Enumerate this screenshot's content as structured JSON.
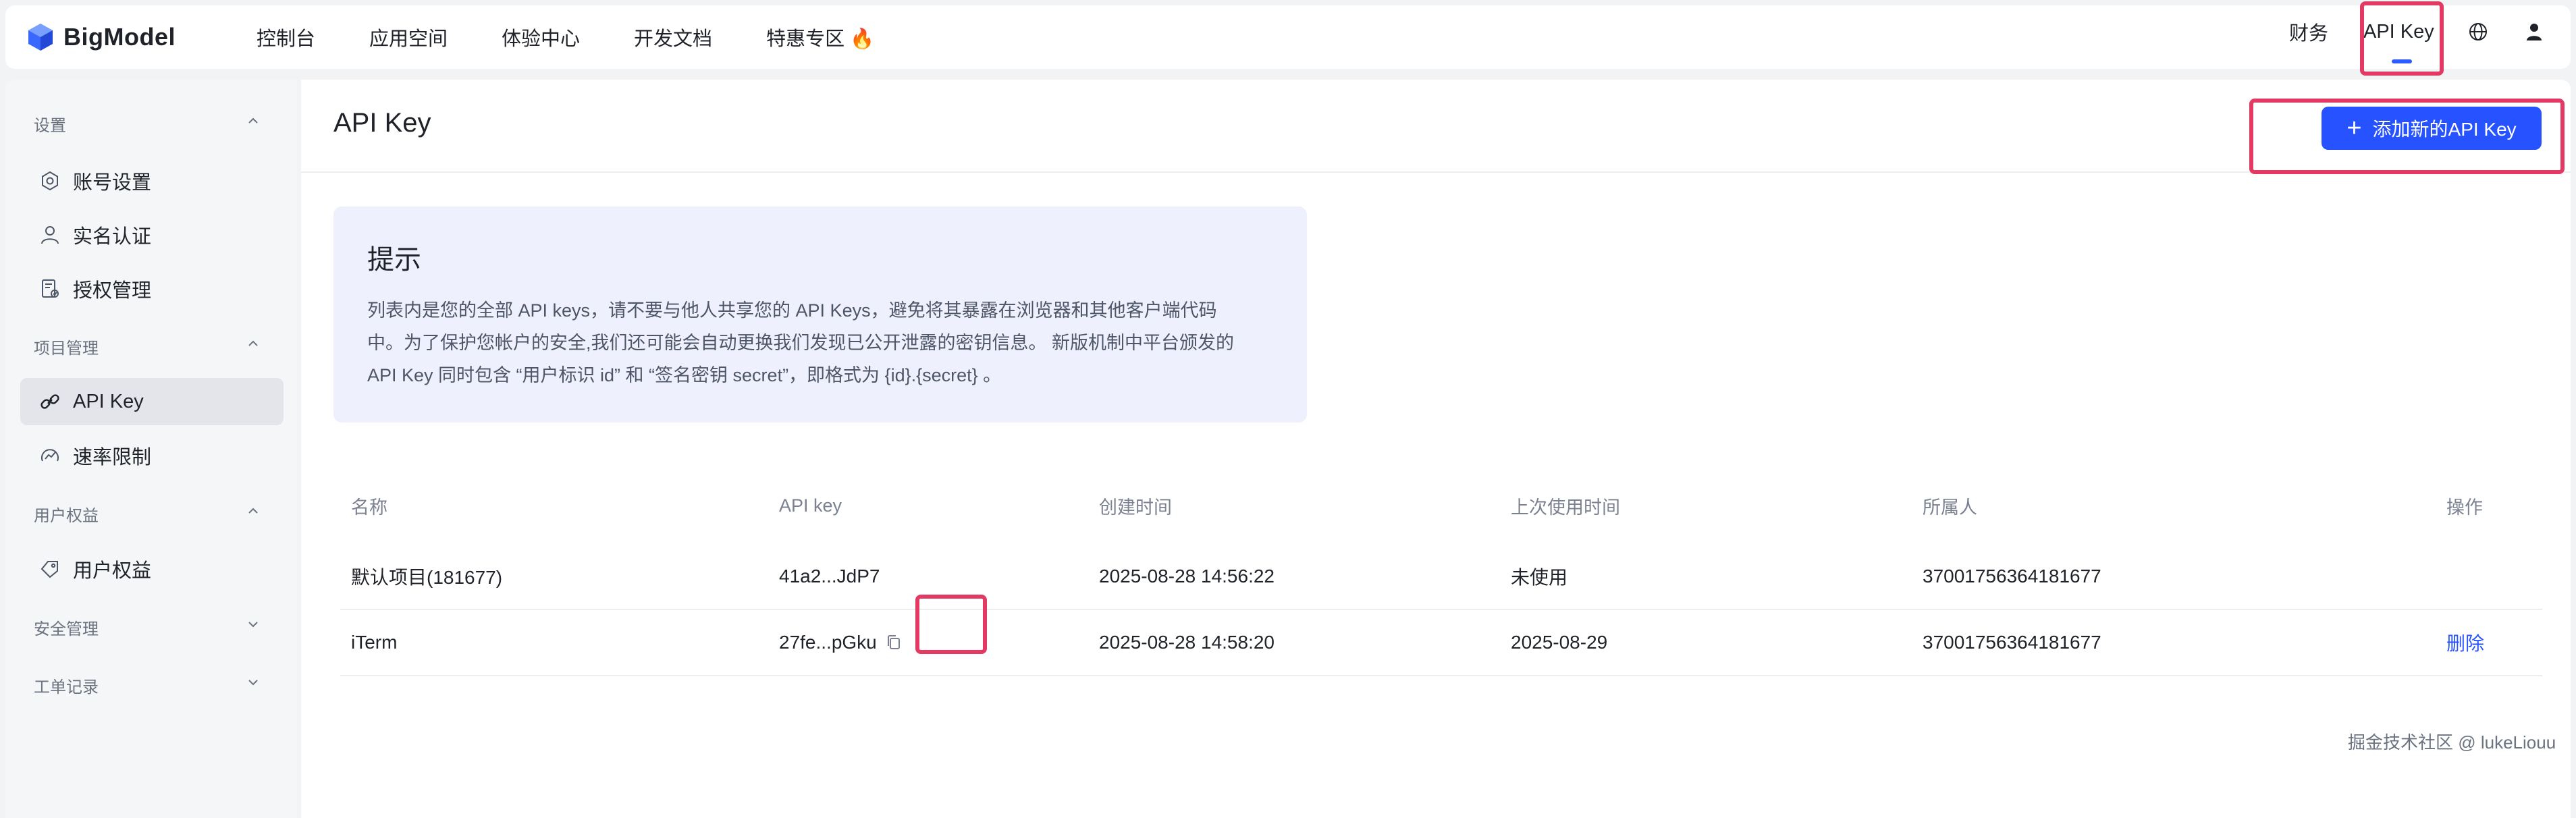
{
  "brand": {
    "name": "BigModel"
  },
  "nav": {
    "items": [
      "控制台",
      "应用空间",
      "体验中心",
      "开发文档",
      "特惠专区 🔥"
    ],
    "finance": "财务",
    "api_key": "API Key"
  },
  "sidebar": {
    "sections": [
      {
        "title": "设置",
        "items": [
          "账号设置",
          "实名认证",
          "授权管理"
        ]
      },
      {
        "title": "项目管理",
        "items": [
          "API Key",
          "速率限制"
        ]
      },
      {
        "title": "用户权益",
        "items": [
          "用户权益"
        ]
      },
      {
        "title": "安全管理",
        "items": []
      },
      {
        "title": "工单记录",
        "items": []
      }
    ],
    "active": "API Key"
  },
  "main": {
    "title": "API Key",
    "add_button": "添加新的API Key",
    "tip": {
      "title": "提示",
      "lines": [
        "列表内是您的全部 API keys，请不要与他人共享您的 API Keys，避免将其暴露在浏览器和其他客户端代码",
        "中。为了保护您帐户的安全,我们还可能会自动更换我们发现已公开泄露的密钥信息。 新版机制中平台颁发的",
        "API Key 同时包含 “用户标识 id” 和 “签名密钥 secret”，即格式为 {id}.{secret} 。"
      ]
    },
    "table": {
      "columns": [
        "名称",
        "API key",
        "创建时间",
        "上次使用时间",
        "所属人",
        "操作"
      ],
      "rows": [
        {
          "name": "默认项目(181677)",
          "key": "41a2...JdP7",
          "created": "2025-08-28 14:56:22",
          "last_used": "未使用",
          "owner": "37001756364181677",
          "action": ""
        },
        {
          "name": "iTerm",
          "key": "27fe...pGku",
          "created": "2025-08-28 14:58:20",
          "last_used": "2025-08-29",
          "owner": "37001756364181677",
          "action": "删除"
        }
      ]
    }
  },
  "watermark": "掘金技术社区 @ lukeLiouu",
  "colors": {
    "accent": "#2652ff",
    "highlight": "#e23a62"
  }
}
